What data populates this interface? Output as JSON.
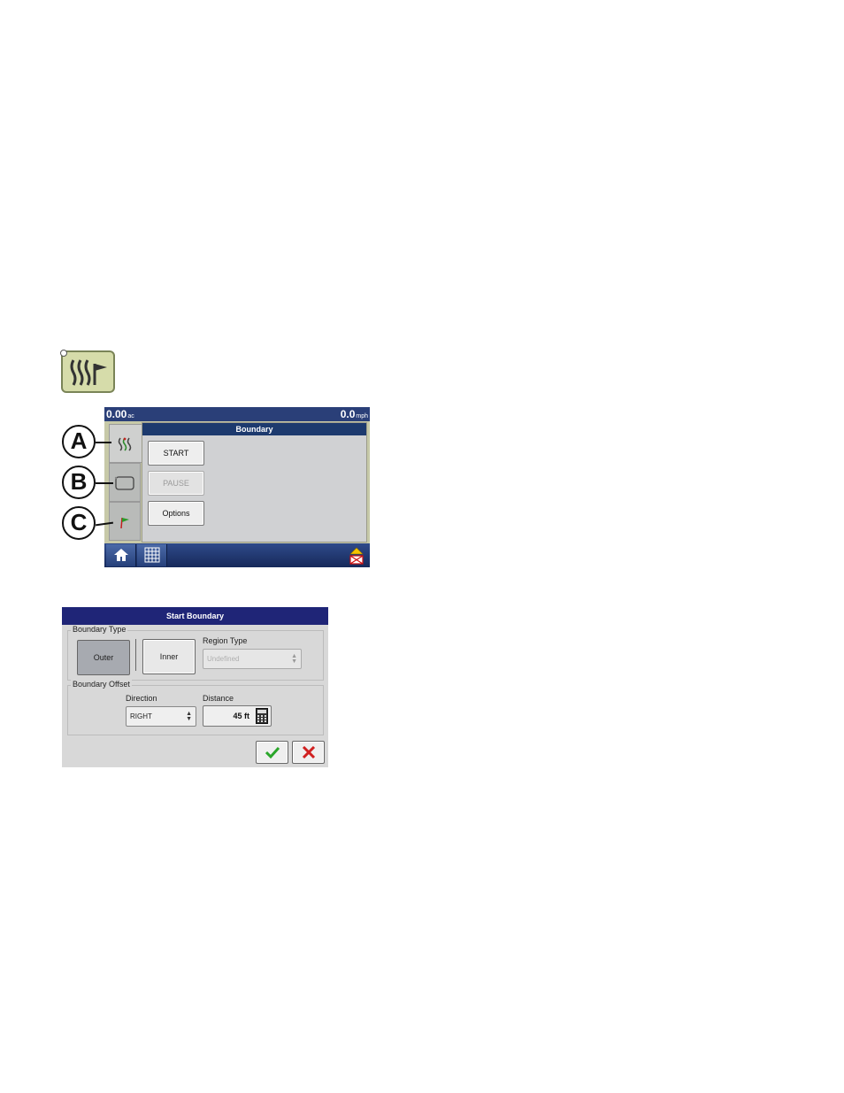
{
  "screen": {
    "area_value": "0.00",
    "area_unit": "ac",
    "speed_value": "0.0",
    "speed_unit": "mph",
    "panel_title": "Boundary",
    "buttons": {
      "start": "START",
      "pause": "PAUSE",
      "options": "Options"
    }
  },
  "callouts": [
    "A",
    "B",
    "C"
  ],
  "dialog": {
    "title": "Start Boundary",
    "boundary_type_label": "Boundary Type",
    "outer": "Outer",
    "inner": "Inner",
    "region_type_label": "Region Type",
    "region_type_value": "Undefined",
    "boundary_offset_label": "Boundary Offset",
    "direction_label": "Direction",
    "direction_value": "RIGHT",
    "distance_label": "Distance",
    "distance_value": "45 ft"
  },
  "icons": [
    "boundary-app-icon",
    "home-icon",
    "grid-icon",
    "alert-icon",
    "calculator-icon",
    "check-icon",
    "x-icon"
  ],
  "colors": {
    "title_bar": "#1f2577",
    "status_bar": "#2a3f78",
    "ok_green": "#2aa62a",
    "cancel_red": "#d02020"
  }
}
